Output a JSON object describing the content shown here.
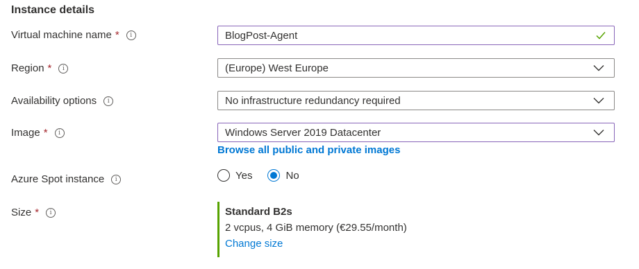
{
  "section": {
    "title": "Instance details"
  },
  "fields": {
    "vm_name": {
      "label": "Virtual machine name",
      "required": "*",
      "value": "BlogPost-Agent"
    },
    "region": {
      "label": "Region",
      "required": "*",
      "value": "(Europe) West Europe"
    },
    "availability": {
      "label": "Availability options",
      "value": "No infrastructure redundancy required"
    },
    "image": {
      "label": "Image",
      "required": "*",
      "value": "Windows Server 2019 Datacenter",
      "link": "Browse all public and private images"
    },
    "spot": {
      "label": "Azure Spot instance",
      "options": [
        "Yes",
        "No"
      ],
      "selected": "No"
    },
    "size": {
      "label": "Size",
      "required": "*",
      "name": "Standard B2s",
      "description": "2 vcpus, 4 GiB memory (€29.55/month)",
      "change_link": "Change size"
    }
  },
  "icons": {
    "info": "info-icon",
    "valid": "checkmark-icon",
    "dropdown": "chevron-down-icon"
  },
  "colors": {
    "accent": "#0078d4",
    "required": "#a4262c",
    "valid": "#57a300",
    "focus_border": "#8764b8"
  }
}
